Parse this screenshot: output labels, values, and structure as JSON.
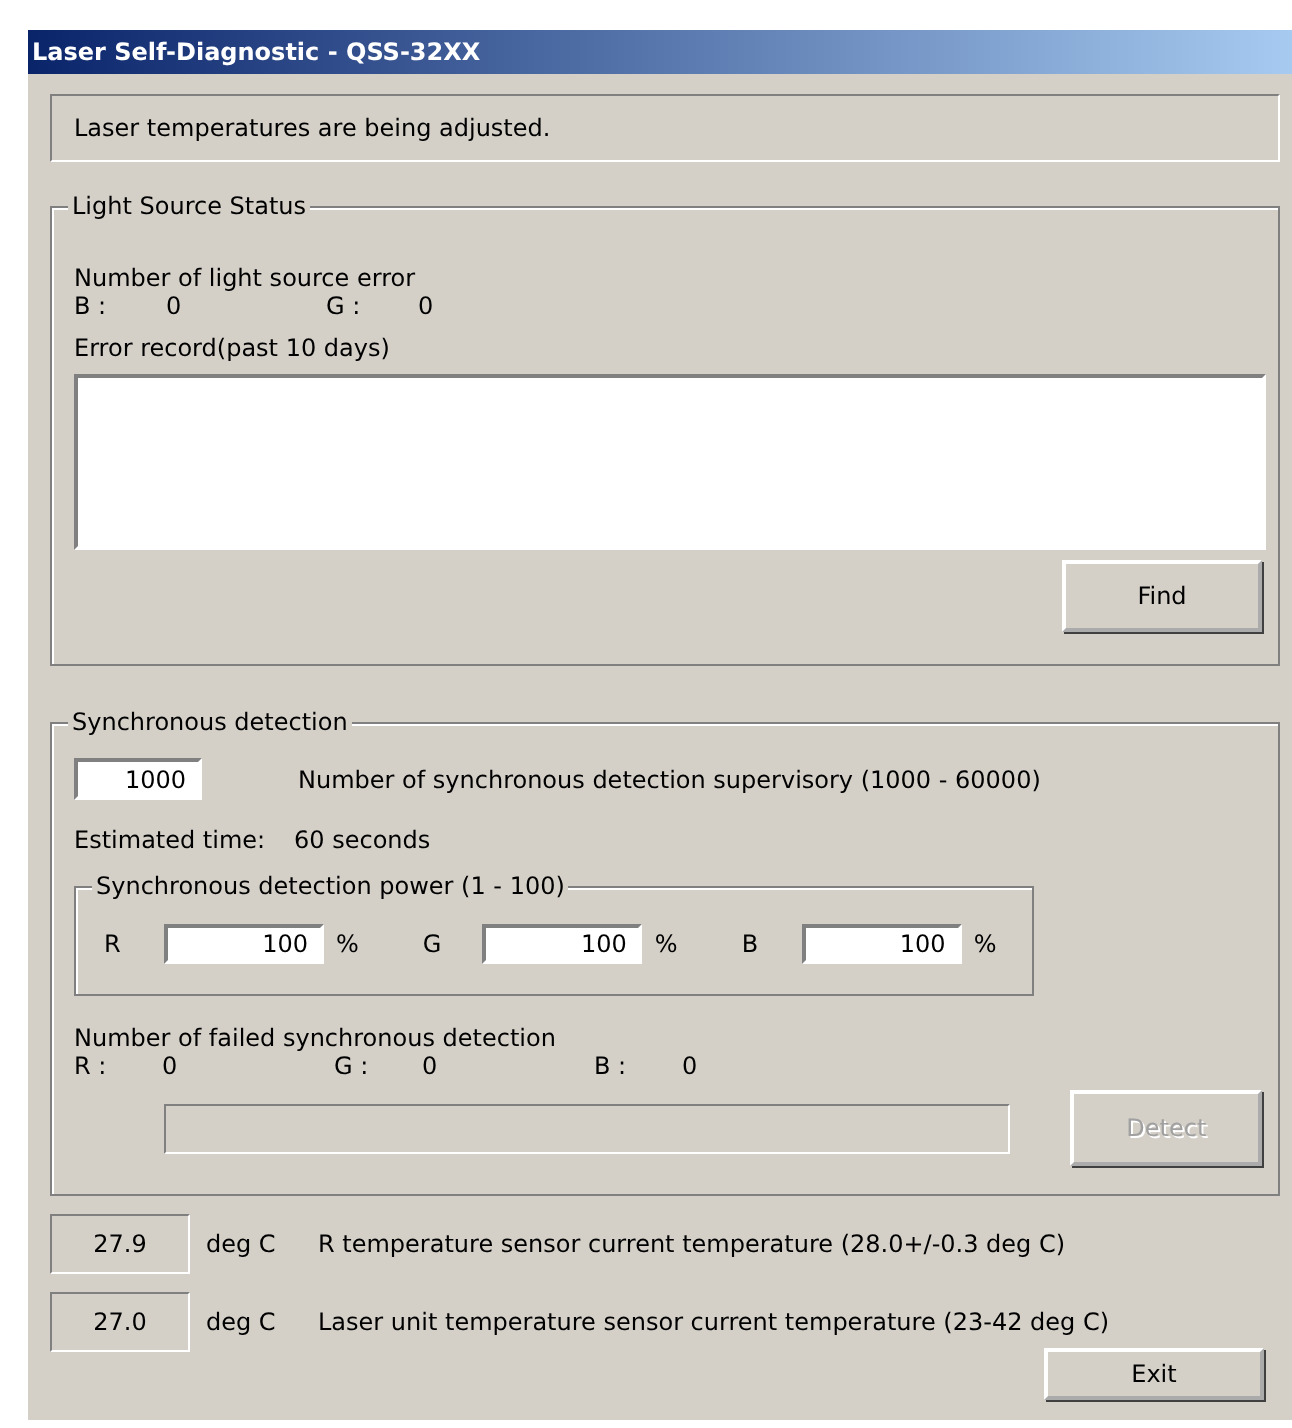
{
  "window": {
    "title": "Laser Self-Diagnostic - QSS-32XX"
  },
  "status_message": "Laser temperatures are being adjusted.",
  "light_source_status": {
    "title": "Light Source Status",
    "error_count_label": "Number of light source error",
    "counts": [
      {
        "label": "B :",
        "value": "0"
      },
      {
        "label": "G :",
        "value": "0"
      }
    ],
    "error_record_label": "Error record(past 10 days)",
    "find_button": "Find"
  },
  "synchronous_detection": {
    "title": "Synchronous detection",
    "supervisory": {
      "value": "1000",
      "label": "Number of synchronous detection supervisory (1000 - 60000)"
    },
    "estimated": {
      "label": "Estimated time:",
      "value": "60 seconds"
    },
    "power": {
      "title": "Synchronous detection power (1 - 100)",
      "channels": [
        {
          "label": "R",
          "value": "100",
          "unit": "%"
        },
        {
          "label": "G",
          "value": "100",
          "unit": "%"
        },
        {
          "label": "B",
          "value": "100",
          "unit": "%"
        }
      ]
    },
    "failed_label": "Number of failed synchronous detection",
    "failed_counts": [
      {
        "label": "R :",
        "value": "0"
      },
      {
        "label": "G :",
        "value": "0"
      },
      {
        "label": "B :",
        "value": "0"
      }
    ],
    "progress": {
      "level": 0
    },
    "detect_button": {
      "label": "Detect",
      "disabled": true
    }
  },
  "temperatures": [
    {
      "value": "27.9",
      "unit": "deg C",
      "description": "R temperature sensor current temperature (28.0+/-0.3 deg C)"
    },
    {
      "value": "27.0",
      "unit": "deg C",
      "description": "Laser unit temperature sensor current temperature (23-42 deg C)"
    }
  ],
  "exit_button": "Exit"
}
